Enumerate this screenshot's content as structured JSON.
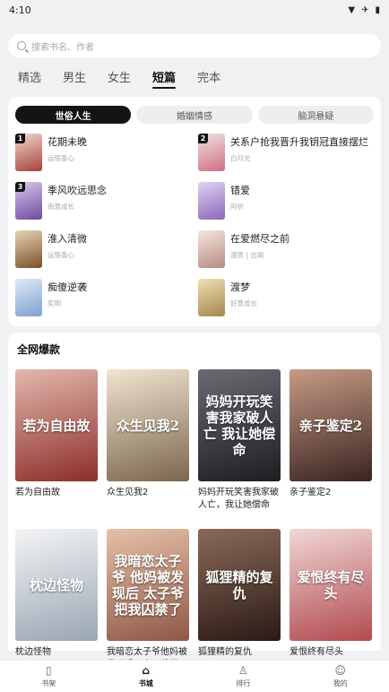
{
  "status_bar": {
    "time": "4:10",
    "icons": [
      "wifi-icon",
      "airplane-icon",
      "battery-icon"
    ]
  },
  "search": {
    "placeholder": "搜索书名、作者"
  },
  "tabs": [
    {
      "label": "精选",
      "active": false
    },
    {
      "label": "男生",
      "active": false
    },
    {
      "label": "女生",
      "active": false
    },
    {
      "label": "短篇",
      "active": true
    },
    {
      "label": "完本",
      "active": false
    }
  ],
  "segments": [
    {
      "label": "世俗人生",
      "active": true
    },
    {
      "label": "婚姻情感",
      "active": false
    },
    {
      "label": "脑洞悬疑",
      "active": false
    }
  ],
  "ranking": [
    {
      "rank": "1",
      "title": "花期未晚",
      "author": "运悟香心",
      "colors": [
        "#f1d9cf",
        "#a5423c"
      ]
    },
    {
      "rank": "2",
      "title": "关系户抢我晋升我钥冠直接摆烂",
      "author": "白月光",
      "colors": [
        "#f0e1e4",
        "#d06f83"
      ]
    },
    {
      "rank": "3",
      "title": "季风吹远思念",
      "author": "南意成长",
      "colors": [
        "#d7c7ee",
        "#6d4c9c"
      ]
    },
    {
      "rank": "",
      "title": "错爱",
      "author": "阿祈",
      "colors": [
        "#ddd4f1",
        "#8b67b8"
      ]
    },
    {
      "rank": "",
      "title": "淮入清微",
      "author": "运悟香心",
      "colors": [
        "#e8d5b3",
        "#7a4f2b"
      ]
    },
    {
      "rank": "",
      "title": "在爱燃尽之前",
      "author": "漫思 | 出阁",
      "colors": [
        "#f4e6df",
        "#b88a80"
      ]
    },
    {
      "rank": "",
      "title": "痴傻逆袭",
      "author": "奕明",
      "colors": [
        "#dfeaf6",
        "#7ea0cc"
      ]
    },
    {
      "rank": "",
      "title": "渡梦",
      "author": "好意成长",
      "colors": [
        "#efe0b6",
        "#a4864a"
      ]
    }
  ],
  "hot_section": {
    "title": "全网爆款",
    "books": [
      {
        "title": "若为自由故",
        "cover_text": "若为自由故",
        "colors": [
          "#e3b7ad",
          "#8c2e2a"
        ]
      },
      {
        "title": "众生见我2",
        "cover_text": "众生见我2",
        "colors": [
          "#f2e4cf",
          "#7b6650"
        ]
      },
      {
        "title": "妈妈开玩笑害我家破人亡，我让她偿命",
        "cover_text": "妈妈开玩笑害我家破人亡 我让她偿命",
        "colors": [
          "#6a6a72",
          "#1d1d22"
        ]
      },
      {
        "title": "亲子鉴定2",
        "cover_text": "亲子鉴定2",
        "colors": [
          "#c69a86",
          "#3a2420"
        ]
      },
      {
        "title": "枕边怪物",
        "cover_text": "枕边怪物",
        "colors": [
          "#f3f4f5",
          "#9aa6b3"
        ]
      },
      {
        "title": "我暗恋太子爷他妈被发现后，太子爷把...",
        "cover_text": "我暗恋太子爷 他妈被发现后 太子爷把我囚禁了",
        "colors": [
          "#e6c0a8",
          "#8e5846"
        ]
      },
      {
        "title": "狐狸精的复仇",
        "cover_text": "狐狸精的复仇",
        "colors": [
          "#8a6a58",
          "#2b1a16"
        ]
      },
      {
        "title": "爱恨终有尽头",
        "cover_text": "爱恨终有尽头",
        "colors": [
          "#f1d7d5",
          "#b14a4f"
        ]
      }
    ]
  },
  "bottom_nav": [
    {
      "label": "书架",
      "icon": "book-icon",
      "glyph": "▯",
      "active": false
    },
    {
      "label": "书城",
      "icon": "home-icon",
      "glyph": "⌂",
      "active": true
    },
    {
      "label": "排行",
      "icon": "rank-icon",
      "glyph": "♙",
      "active": false
    },
    {
      "label": "我的",
      "icon": "profile-icon",
      "glyph": "☺",
      "active": false
    }
  ]
}
